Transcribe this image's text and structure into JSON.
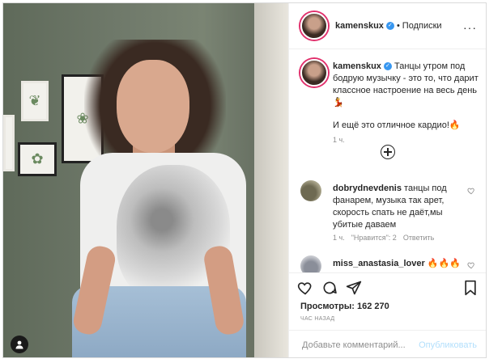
{
  "post": {
    "username": "kamenskux",
    "dot": "•",
    "follow_label": "Подписки",
    "caption_line1": "Танцы утром под бодрую музычку - это то, что дарит классное настроение на весь день💃",
    "caption_line2": "И ещё это отличное кардио!🔥",
    "caption_time": "1 ч."
  },
  "comments": [
    {
      "username": "dobrydnevdenis",
      "text": "танцы под фанарем, музыка так арет, скорость спать не даёт,мы убитые даваем",
      "time": "1 ч.",
      "likes_label": "\"Нравится\": 2",
      "reply_label": "Ответить"
    },
    {
      "username": "miss_anastasia_lover",
      "text": "🔥🔥🔥"
    }
  ],
  "actions": {
    "views_label": "Просмотры: 162 270",
    "time_ago": "ЧАС НАЗАД",
    "add_comment_placeholder": "Добавьте комментарий...",
    "post_button": "Опубликовать"
  },
  "icons": {
    "header_more": "more-icon",
    "verified": "verified-badge-icon",
    "add": "plus-circle-icon",
    "like": "heart-icon",
    "comment": "comment-icon",
    "share": "share-icon",
    "save": "bookmark-icon",
    "user_tag": "user-tag-icon"
  },
  "colors": {
    "verified": "#3897f0",
    "story_ring": "#e1306c",
    "post_button_disabled": "#b2dffc"
  }
}
